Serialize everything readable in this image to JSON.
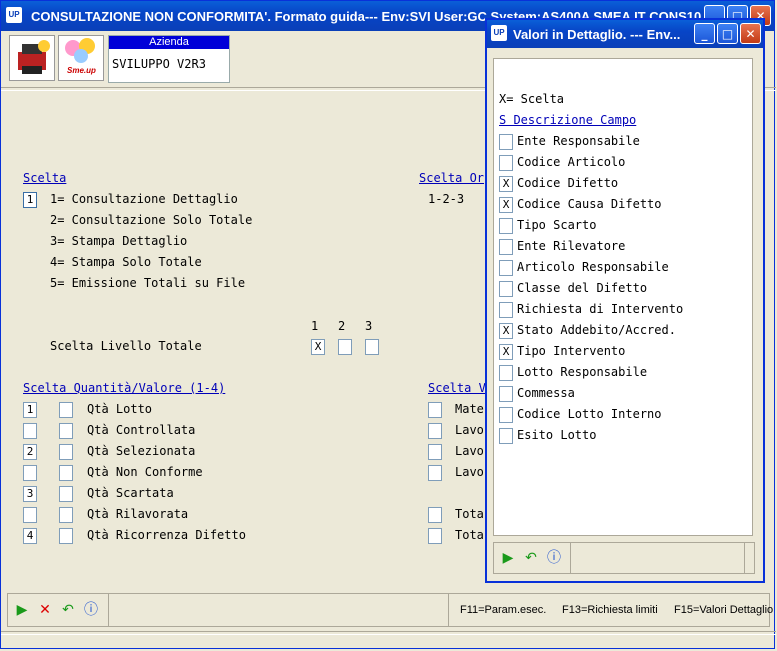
{
  "main_title": "CONSULTAZIONE NON CONFORMITA'.  Formato guida--- Env:SVI User:GC System:AS400A SMEA IT  CONS10",
  "app_icon": "UP",
  "azienda": {
    "label": "Azienda",
    "value": "SVILUPPO V2R3"
  },
  "logo2_text": "Sme.up",
  "scelta": {
    "header": "Scelta",
    "selected_value": "1",
    "options": [
      "1= Consultazione Dettaglio",
      "2= Consultazione Solo Totale",
      "3= Stampa Dettaglio",
      "4= Stampa Solo Totale",
      "5= Emissione Totali su File"
    ]
  },
  "scelta_ord": {
    "header": "Scelta Or",
    "range": "1-2-3"
  },
  "livello": {
    "label": "Scelta Livello Totale",
    "cols": [
      "1",
      "2",
      "3"
    ],
    "values": [
      "X",
      "",
      ""
    ]
  },
  "quantita": {
    "header": "Scelta Quantità/Valore (1-4)",
    "rows": [
      {
        "num": "1",
        "label": "Qtà Lotto"
      },
      {
        "num": "",
        "label": "Qtà Controllata"
      },
      {
        "num": "2",
        "label": "Qtà Selezionata"
      },
      {
        "num": "",
        "label": "Qtà Non Conforme"
      },
      {
        "num": "3",
        "label": "Qtà Scartata"
      },
      {
        "num": "",
        "label": "Qtà Rilavorata"
      },
      {
        "num": "4",
        "label": "Qtà Ricorrenza Difetto"
      }
    ]
  },
  "scelta_v": {
    "header": "Scelta V",
    "rows": [
      "Mate",
      "Lavo",
      "Lavo",
      "Lavo",
      "Tota",
      "Tota"
    ]
  },
  "fkeys": {
    "f11": "F11=Param.esec.",
    "f13": "F13=Richiesta limiti",
    "f15": "F15=Valori Dettaglio"
  },
  "popup": {
    "title": "Valori in Dettaglio. --- Env...",
    "legend": "X= Scelta",
    "header": "S Descrizione Campo",
    "items": [
      {
        "mark": "",
        "label": "Ente Responsabile"
      },
      {
        "mark": "",
        "label": "Codice Articolo"
      },
      {
        "mark": "X",
        "label": "Codice Difetto"
      },
      {
        "mark": "X",
        "label": "Codice Causa Difetto"
      },
      {
        "mark": "",
        "label": "Tipo Scarto"
      },
      {
        "mark": "",
        "label": "Ente Rilevatore"
      },
      {
        "mark": "",
        "label": "Articolo Responsabile"
      },
      {
        "mark": "",
        "label": "Classe del Difetto"
      },
      {
        "mark": "",
        "label": "Richiesta di Intervento"
      },
      {
        "mark": "X",
        "label": "Stato Addebito/Accred."
      },
      {
        "mark": "X",
        "label": "Tipo Intervento"
      },
      {
        "mark": "",
        "label": "Lotto Responsabile"
      },
      {
        "mark": "",
        "label": "Commessa"
      },
      {
        "mark": "",
        "label": "Codice Lotto Interno"
      },
      {
        "mark": "",
        "label": "Esito Lotto"
      }
    ]
  }
}
